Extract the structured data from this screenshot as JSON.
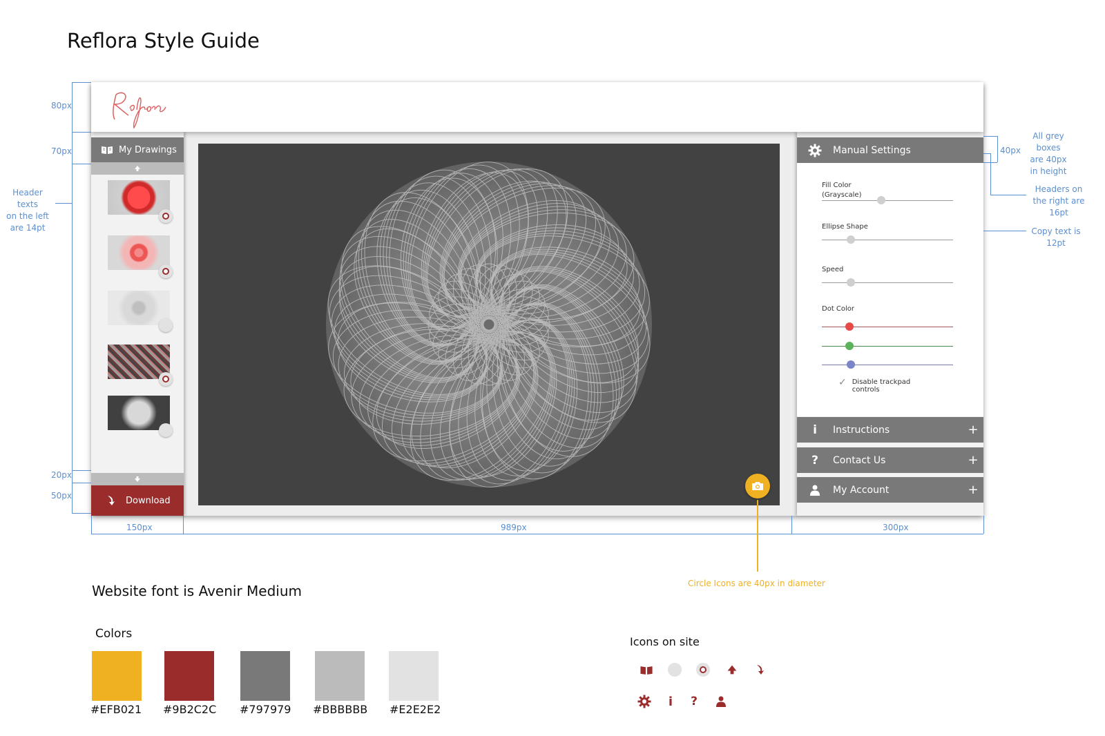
{
  "page": {
    "title": "Reflora Style Guide"
  },
  "app": {
    "logo": {
      "text": "Reflora",
      "icon": "reflora-script-logo"
    },
    "sidebar": {
      "header_label": "My Drawings",
      "header_icon": "open-book-icon",
      "download_label": "Download",
      "download_icon": "curved-arrow-icon"
    },
    "right_panel": {
      "manual_settings_label": "Manual Settings",
      "settings": {
        "fill_color_label": "Fill Color",
        "fill_color_sub": "(Grayscale)",
        "ellipse_shape_label": "Ellipse Shape",
        "speed_label": "Speed",
        "dot_color_label": "Dot Color",
        "disable_trackpad_line1": "Disable trackpad",
        "disable_trackpad_line2": "controls",
        "slider_values": {
          "fill_color": 0.45,
          "ellipse_shape": 0.22,
          "speed": 0.22,
          "dot_red": 0.21,
          "dot_green": 0.21,
          "dot_blue": 0.22
        }
      },
      "instructions_label": "Instructions",
      "contact_label": "Contact Us",
      "account_label": "My Account",
      "plus": "+"
    }
  },
  "annotations": {
    "h80": "80px",
    "h70": "70px",
    "h20": "20px",
    "h50": "50px",
    "left_note": [
      "Header texts",
      "on the left",
      "are 14pt"
    ],
    "w150": "150px",
    "w989": "989px",
    "w300": "300px",
    "h40": "40px",
    "grey_boxes_note": [
      "All grey",
      "boxes",
      "are 40px",
      "in height"
    ],
    "headers_right_note": [
      "Headers on",
      "the right are",
      "16pt"
    ],
    "copy_text_note": [
      "Copy text is",
      "12pt"
    ],
    "circle_icons_note": "Circle Icons are 40px in diameter"
  },
  "font_note": "Website font is Avenir Medium",
  "colors": {
    "title": "Colors",
    "swatches": [
      {
        "hex": "#EFB021",
        "label": "#EFB021"
      },
      {
        "hex": "#9B2C2C",
        "label": "#9B2C2C"
      },
      {
        "hex": "#797979",
        "label": "#797979"
      },
      {
        "hex": "#BBBBBB",
        "label": "#BBBBBB"
      },
      {
        "hex": "#E2E2E2",
        "label": "#E2E2E2"
      }
    ]
  },
  "icons_on_site": {
    "title": "Icons on site",
    "row1": [
      "open-book-icon",
      "grey-circle-icon",
      "red-ring-icon",
      "up-arrow-icon",
      "curved-arrow-icon"
    ],
    "row2": [
      "gear-icon",
      "info-icon",
      "question-icon",
      "person-icon"
    ]
  }
}
